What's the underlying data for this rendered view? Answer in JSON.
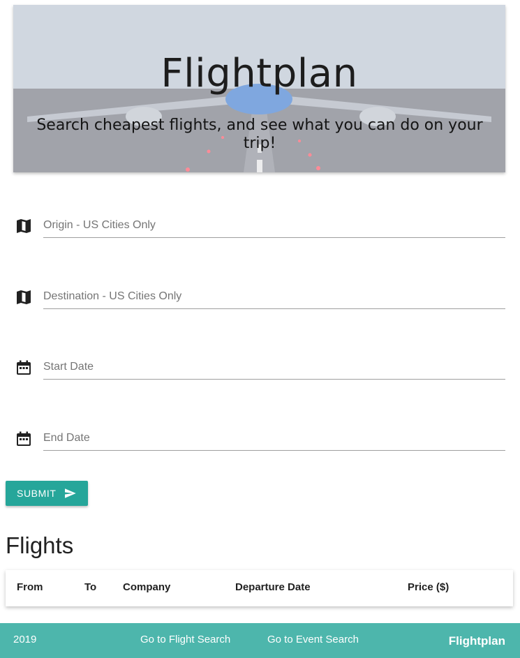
{
  "hero": {
    "title": "Flightplan",
    "subtitle": "Search cheapest flights, and see what you can do on your trip!"
  },
  "form": {
    "origin_placeholder": "Origin - US Cities Only",
    "destination_placeholder": "Destination - US Cities Only",
    "start_date_placeholder": "Start Date",
    "end_date_placeholder": "End Date",
    "submit_label": "SUBMIT",
    "icons": {
      "origin": "map-icon",
      "destination": "map-icon",
      "start_date": "calendar-icon",
      "end_date": "calendar-icon",
      "submit": "send-icon"
    }
  },
  "flights": {
    "heading": "Flights",
    "columns": [
      "From",
      "To",
      "Company",
      "Departure Date",
      "Price ($)"
    ]
  },
  "footer": {
    "year": "2019",
    "flight_search_link": "Go to Flight Search",
    "event_search_link": "Go to Event Search",
    "brand": "Flightplan"
  },
  "colors": {
    "accent": "#26a69a",
    "footer": "#4db6ac"
  }
}
